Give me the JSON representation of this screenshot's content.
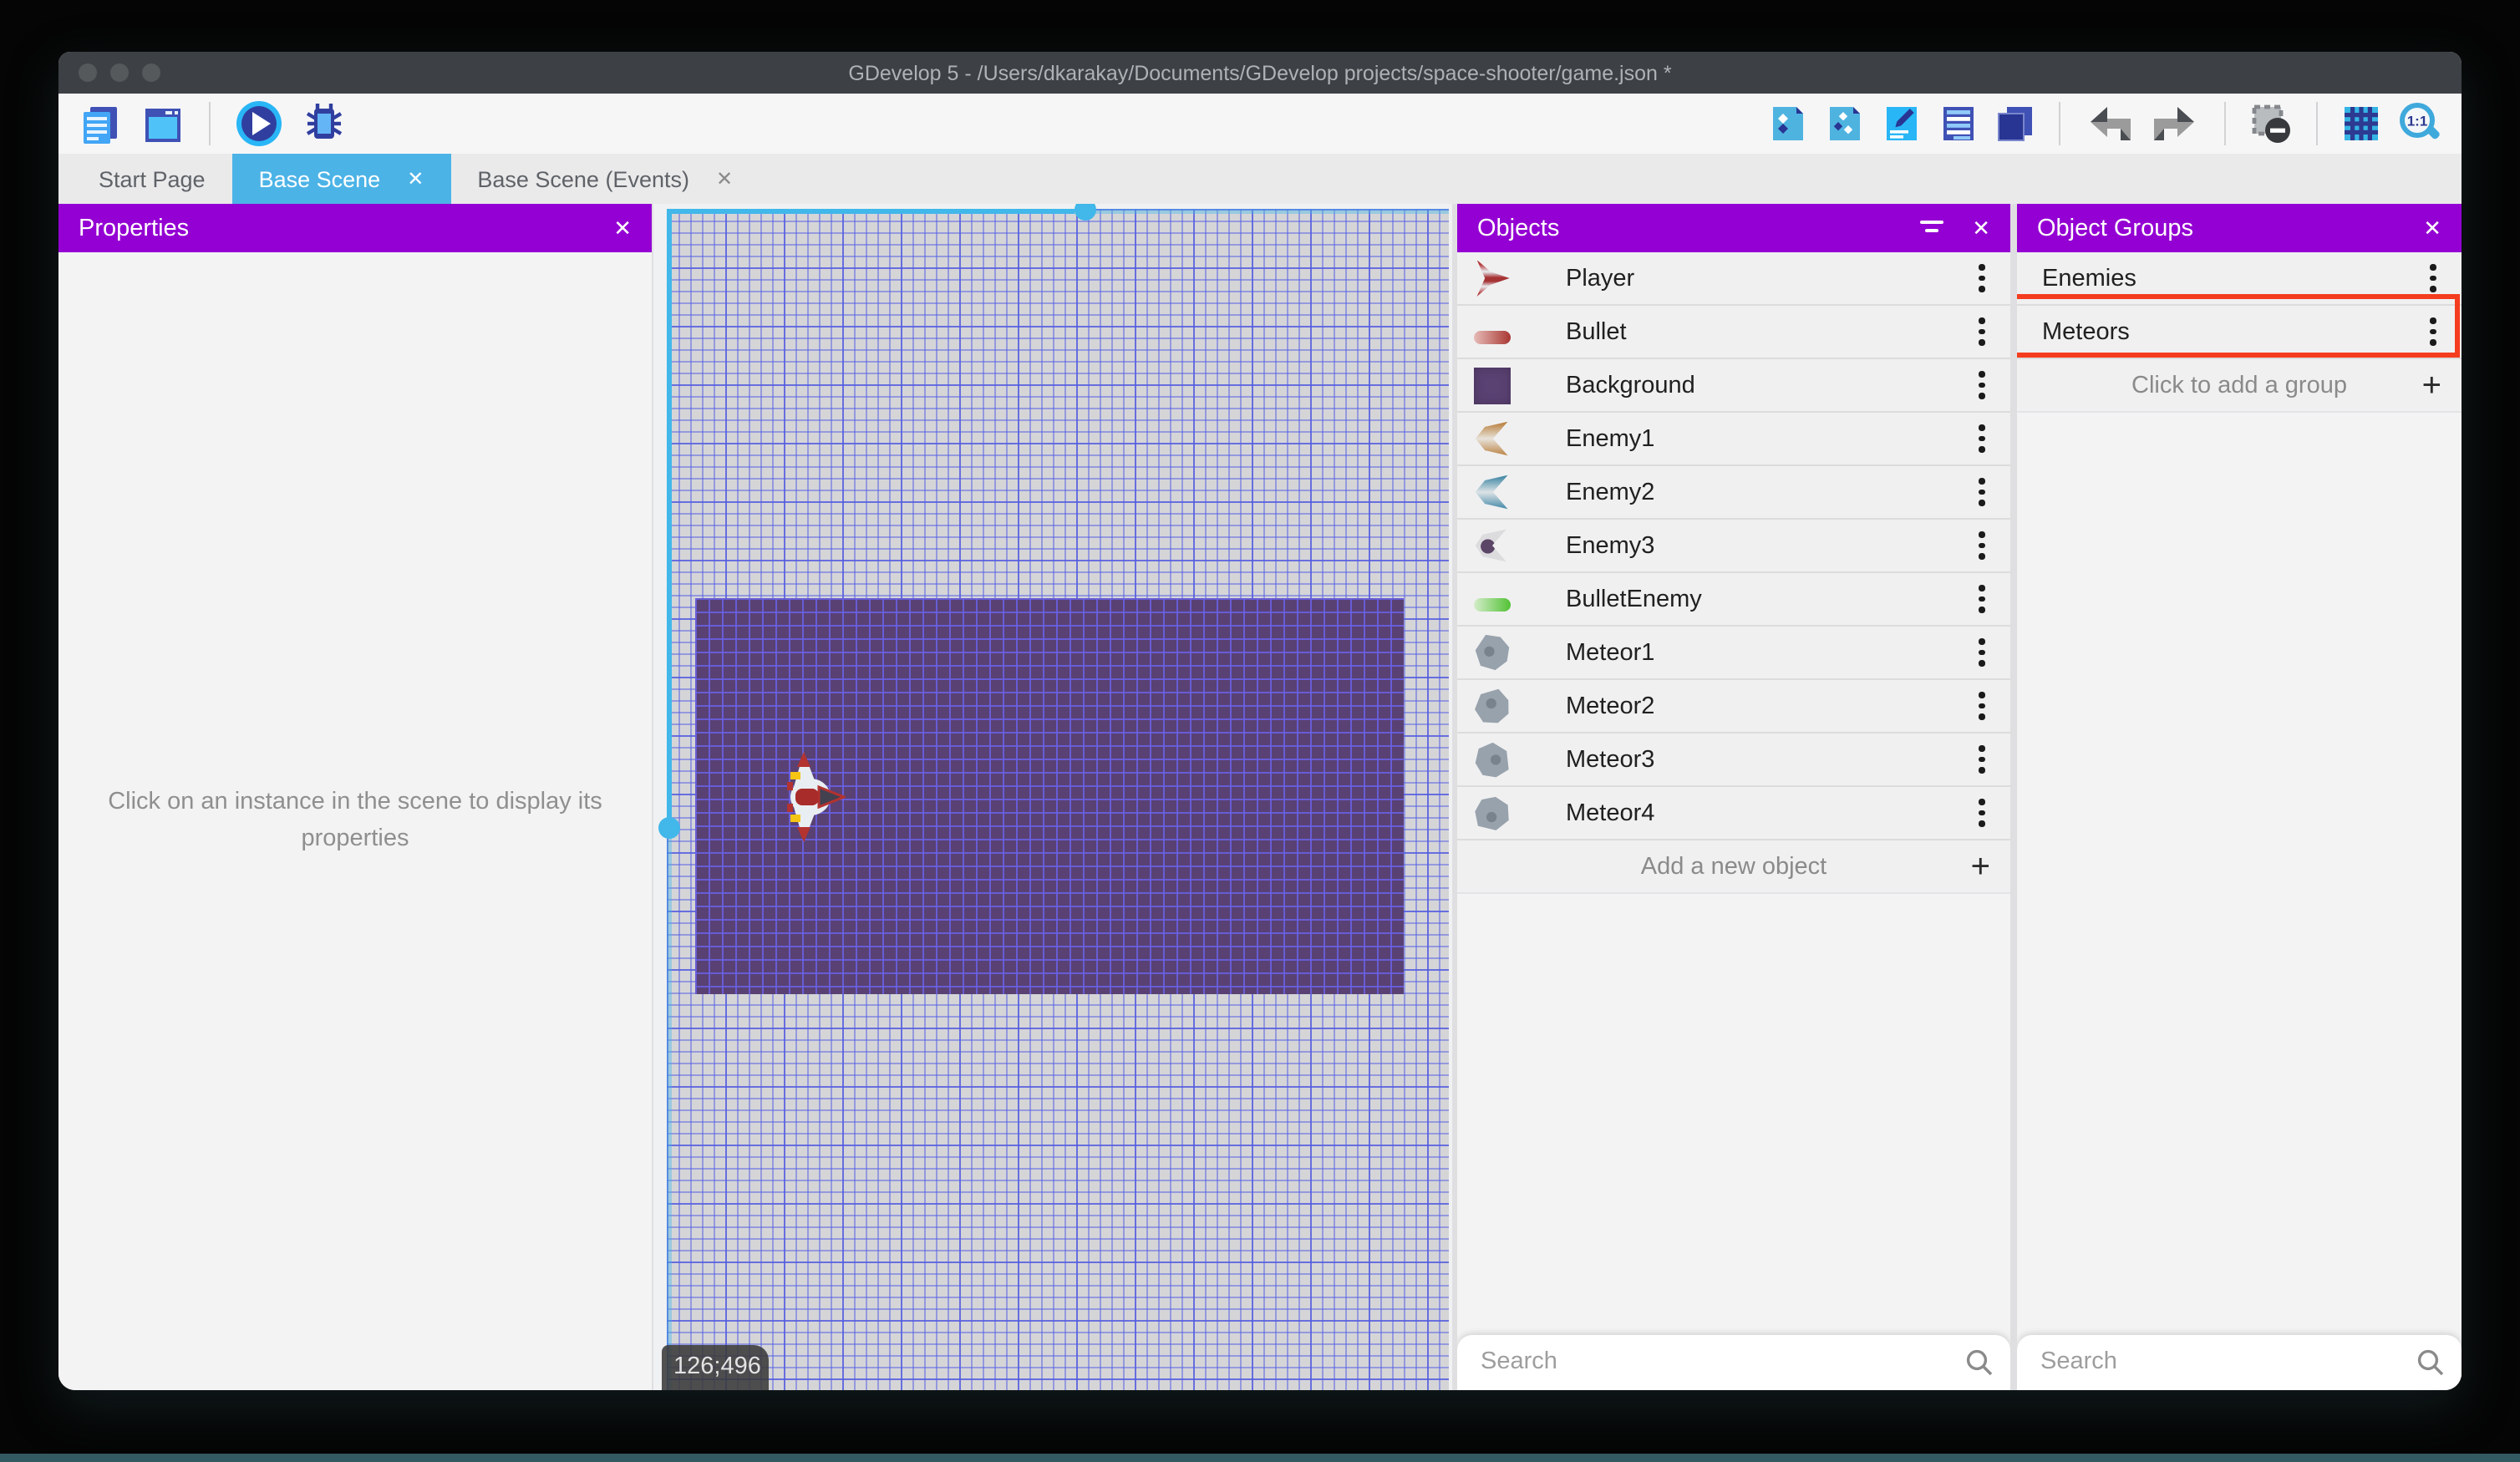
{
  "window": {
    "title": "GDevelop 5 - /Users/dkarakay/Documents/GDevelop projects/space-shooter/game.json *",
    "traffic_lights": [
      "close",
      "minimize",
      "fullscreen"
    ]
  },
  "toolbar": {
    "left_icons": [
      "project-manager-icon",
      "scene-window-icon",
      "play-icon",
      "debug-icon"
    ],
    "right_icons": [
      "objects-panel-icon",
      "object-groups-panel-icon",
      "properties-panel-icon",
      "instances-list-icon",
      "layers-panel-icon",
      "undo-icon",
      "redo-icon",
      "toggle-window-mask-icon",
      "toggle-grid-icon",
      "zoom-1-1-icon"
    ]
  },
  "tabs": {
    "items": [
      {
        "label": "Start Page",
        "active": false,
        "closable": false
      },
      {
        "label": "Base Scene",
        "active": true,
        "closable": true
      },
      {
        "label": "Base Scene (Events)",
        "active": false,
        "closable": true
      }
    ],
    "close_glyph": "✕"
  },
  "properties_panel": {
    "title": "Properties",
    "close_glyph": "✕",
    "empty_message": "Click on an instance in the scene to display its properties"
  },
  "scene": {
    "cursor_coordinates": "126;496",
    "selection_color": "#41b7ea",
    "game_background_color": "#594173"
  },
  "objects_panel": {
    "title": "Objects",
    "close_glyph": "✕",
    "add_label": "Add a new object",
    "plus_glyph": "+",
    "search_placeholder": "Search",
    "items": [
      {
        "label": "Player",
        "thumb": "player"
      },
      {
        "label": "Bullet",
        "thumb": "bullet"
      },
      {
        "label": "Background",
        "thumb": "background"
      },
      {
        "label": "Enemy1",
        "thumb": "enemy1"
      },
      {
        "label": "Enemy2",
        "thumb": "enemy2"
      },
      {
        "label": "Enemy3",
        "thumb": "enemy3"
      },
      {
        "label": "BulletEnemy",
        "thumb": "bullet-enemy"
      },
      {
        "label": "Meteor1",
        "thumb": "meteor1"
      },
      {
        "label": "Meteor2",
        "thumb": "meteor2"
      },
      {
        "label": "Meteor3",
        "thumb": "meteor3"
      },
      {
        "label": "Meteor4",
        "thumb": "meteor4"
      }
    ]
  },
  "object_groups_panel": {
    "title": "Object Groups",
    "close_glyph": "✕",
    "add_label": "Click to add a group",
    "plus_glyph": "+",
    "search_placeholder": "Search",
    "highlighted_item": "Meteors",
    "highlight_color": "#f43d1e",
    "items": [
      {
        "label": "Enemies"
      },
      {
        "label": "Meteors"
      }
    ]
  },
  "colors": {
    "panel_header_purple": "#9400d3",
    "active_tab_blue": "#4cb3e6",
    "titlebar_gray": "#3d4145"
  }
}
